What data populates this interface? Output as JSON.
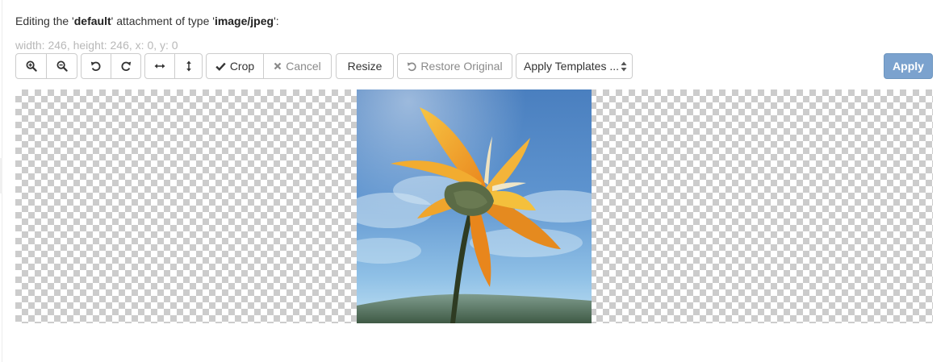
{
  "header": {
    "prefix": "Editing the '",
    "attachment_name": "default",
    "middle": "' attachment of type '",
    "mime_type": "image/jpeg",
    "suffix": "':"
  },
  "dimensions_text": "width: 246, height: 246, x: 0, y: 0",
  "toolbar": {
    "zoom_in_icon": "zoom-in-icon",
    "zoom_out_icon": "zoom-out-icon",
    "rotate_left_icon": "rotate-left-icon",
    "rotate_right_icon": "rotate-right-icon",
    "flip_horizontal_icon": "flip-horizontal-icon",
    "flip_vertical_icon": "flip-vertical-icon",
    "crop_label": "Crop",
    "cancel_label": "Cancel",
    "resize_label": "Resize",
    "restore_label": "Restore Original",
    "templates_label": "Apply Templates ...",
    "apply_label": "Apply"
  },
  "colors": {
    "apply_bg": "#7ba2ce",
    "checker": "#cccccc",
    "muted_text": "#b8b8b8"
  }
}
